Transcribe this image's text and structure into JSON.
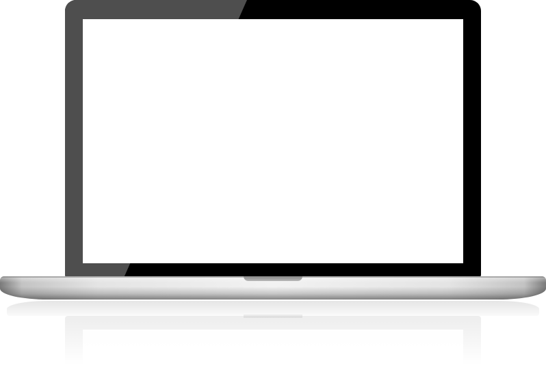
{
  "image": {
    "subject": "laptop-mockup",
    "screen_content": ""
  },
  "colors": {
    "bezel": "#000000",
    "bezel_glare": "#4e4e4e",
    "screen": "#ffffff",
    "base_highlight": "#f2f2f2",
    "base_edge": "#7a7a7a",
    "background": "#ffffff"
  }
}
